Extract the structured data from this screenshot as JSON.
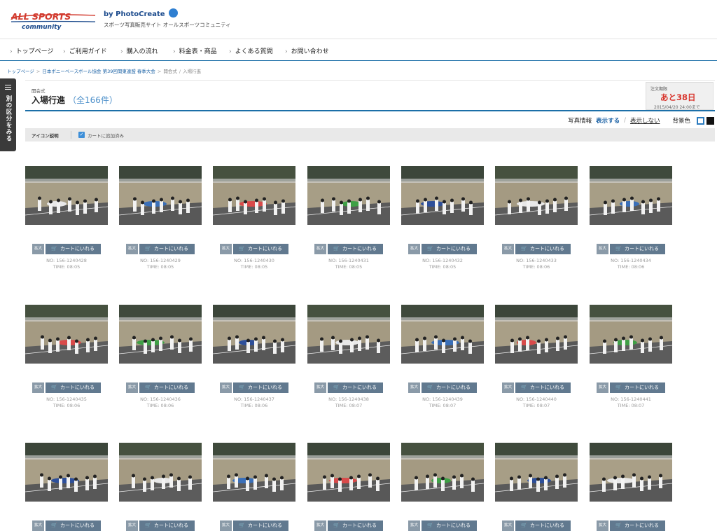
{
  "header": {
    "logo_line1": "ALL SPORTS",
    "logo_line2": "community",
    "by_text": "by",
    "brand": "PhotoCreate",
    "tagline": "スポーツ写真販売サイト オールスポーツコミュニティ"
  },
  "nav": [
    "トップページ",
    "ご利用ガイド",
    "購入の流れ",
    "料金表・商品",
    "よくある質問",
    "お問い合わせ"
  ],
  "breadcrumb": [
    "トップページ",
    "日本ポニーベースボール協会 第39回関東連盟 春季大会",
    "開会式",
    "入場行進"
  ],
  "side_tab": "別の区分をみる",
  "event_label": "開会式",
  "page_title": "入場行進",
  "page_count": "（全166件）",
  "deadline": {
    "label": "注文期限",
    "value": "あと38日",
    "date": "2015/04/20 24:00まで"
  },
  "photo_info": {
    "label": "写真情報",
    "show": "表示する",
    "slash": "/",
    "hide": "表示しない",
    "bg_label": "背景色"
  },
  "legend": {
    "title": "アイコン説明",
    "check_text": "カートに追加済み"
  },
  "buttons": {
    "zoom": "拡大",
    "cart": "カートにいれる"
  },
  "photos": [
    {
      "no": "NO: 156-1240428",
      "time": "TIME: 08:05"
    },
    {
      "no": "NO: 156-1240429",
      "time": "TIME: 08:05"
    },
    {
      "no": "NO: 156-1240430",
      "time": "TIME: 08:05"
    },
    {
      "no": "NO: 156-1240431",
      "time": "TIME: 08:05"
    },
    {
      "no": "NO: 156-1240432",
      "time": "TIME: 08:05"
    },
    {
      "no": "NO: 156-1240433",
      "time": "TIME: 08:06"
    },
    {
      "no": "NO: 156-1240434",
      "time": "TIME: 08:06"
    },
    {
      "no": "NO: 156-1240435",
      "time": "TIME: 08:06"
    },
    {
      "no": "NO: 156-1240436",
      "time": "TIME: 08:06"
    },
    {
      "no": "NO: 156-1240437",
      "time": "TIME: 08:06"
    },
    {
      "no": "NO: 156-1240438",
      "time": "TIME: 08:07"
    },
    {
      "no": "NO: 156-1240439",
      "time": "TIME: 08:07"
    },
    {
      "no": "NO: 156-1240440",
      "time": "TIME: 08:07"
    },
    {
      "no": "NO: 156-1240441",
      "time": "TIME: 08:07"
    },
    {
      "no": "",
      "time": ""
    },
    {
      "no": "",
      "time": ""
    },
    {
      "no": "",
      "time": ""
    },
    {
      "no": "",
      "time": ""
    },
    {
      "no": "",
      "time": ""
    },
    {
      "no": "",
      "time": ""
    },
    {
      "no": "",
      "time": ""
    }
  ],
  "colors": {
    "accent": "#1c6fa8",
    "deadline": "#d8342c",
    "cart_button": "#61798f",
    "zoom_button": "#8a9aa8"
  }
}
